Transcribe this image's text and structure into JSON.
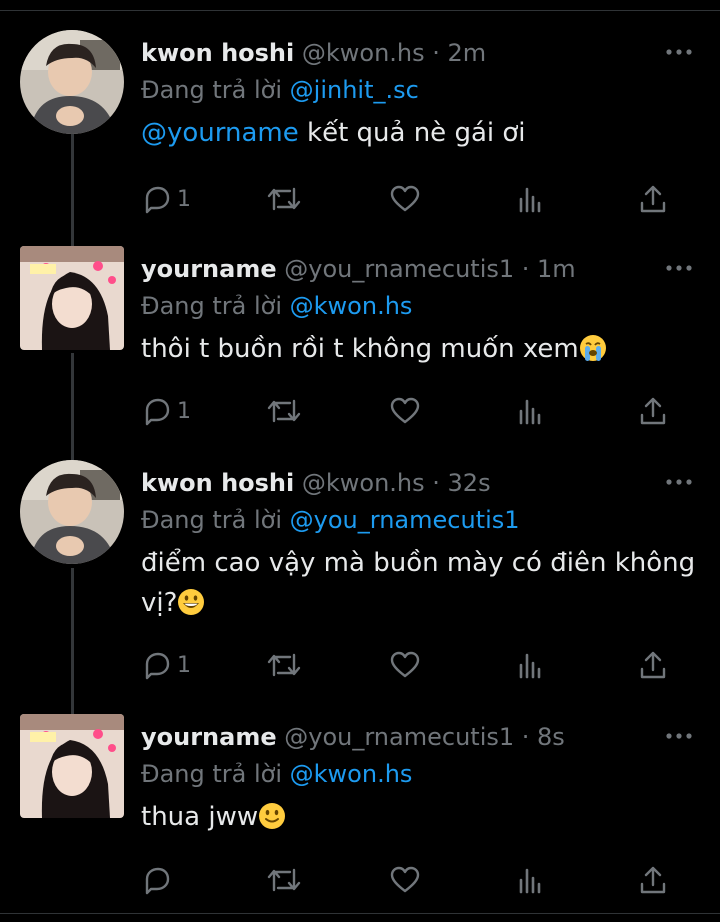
{
  "tweets": [
    {
      "name": "kwon hoshi",
      "handle": "@kwon.hs",
      "time": "2m",
      "reply_prefix": "Đang trả lời",
      "reply_to": "@jinhit_.sc",
      "mention": "@yourname",
      "text": " kết quả nè gái ơi",
      "reply_count": "1",
      "avatar": "male-user-avatar"
    },
    {
      "name": "yourname",
      "handle": "@you_rnamecutis1",
      "time": "1m",
      "reply_prefix": "Đang trả lời",
      "reply_to": "@kwon.hs",
      "text": "thôi t buồn rồi t không muốn xem",
      "emoji": "loudly-crying-face-emoji",
      "reply_count": "1",
      "avatar": "female-user-avatar"
    },
    {
      "name": "kwon hoshi",
      "handle": "@kwon.hs",
      "time": "32s",
      "reply_prefix": "Đang trả lời",
      "reply_to": "@you_rnamecutis1",
      "text": "điểm cao vậy mà buồn mày có điên không vị?",
      "emoji": "grinning-face-emoji",
      "reply_count": "1",
      "avatar": "male-user-avatar"
    },
    {
      "name": "yourname",
      "handle": "@you_rnamecutis1",
      "time": "8s",
      "reply_prefix": "Đang trả lời",
      "reply_to": "@kwon.hs",
      "text": "thua jww",
      "emoji": "slightly-smiling-face-emoji",
      "reply_count": "",
      "avatar": "female-user-avatar"
    }
  ],
  "separator": " · ",
  "colors": {
    "background": "#000000",
    "text": "#e7e9ea",
    "muted": "#71767b",
    "link": "#1d9bf0",
    "thread_line": "#333639"
  },
  "icons": [
    "reply-icon",
    "retweet-icon",
    "like-icon",
    "views-icon",
    "share-icon",
    "more-options-icon"
  ]
}
